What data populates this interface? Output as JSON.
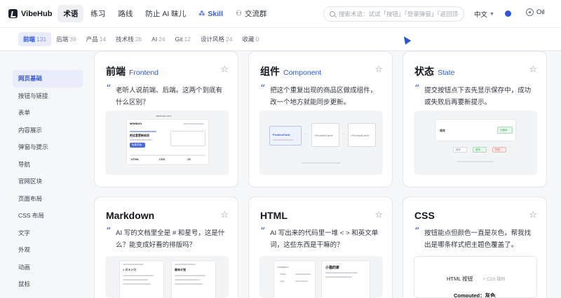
{
  "brand": {
    "name": "VibeHub"
  },
  "nav": {
    "items": [
      {
        "label": "术语",
        "active": true
      },
      {
        "label": "练习"
      },
      {
        "label": "路线"
      },
      {
        "label": "防止 AI 昧儿"
      },
      {
        "label": "Skill"
      },
      {
        "label": "交流群"
      }
    ]
  },
  "search": {
    "placeholder": "搜索术语：试试「按钮」「登录弹窗」「返回顶部」"
  },
  "language": {
    "label": "中文"
  },
  "user": {
    "name": "Oil"
  },
  "categories": [
    {
      "label": "前端",
      "count": "131",
      "active": true
    },
    {
      "label": "后端",
      "count": "39"
    },
    {
      "label": "产品",
      "count": "14"
    },
    {
      "label": "技术栈",
      "count": "26"
    },
    {
      "label": "AI",
      "count": "24"
    },
    {
      "label": "Git",
      "count": "12"
    },
    {
      "label": "设计风格",
      "count": "24"
    },
    {
      "label": "收藏",
      "count": "0"
    }
  ],
  "sidebar": {
    "items": [
      {
        "label": "网页基础",
        "active": true
      },
      {
        "label": "按钮与链接"
      },
      {
        "label": "表单"
      },
      {
        "label": "内容展示"
      },
      {
        "label": "弹窗与提示"
      },
      {
        "label": "导航"
      },
      {
        "label": "官网区块"
      },
      {
        "label": "页面布局"
      },
      {
        "label": "CSS 布局"
      },
      {
        "label": "文字"
      },
      {
        "label": "外观"
      },
      {
        "label": "动画"
      },
      {
        "label": "鼠标"
      }
    ]
  },
  "cards": [
    {
      "title": "前端",
      "subtitle": "Frontend",
      "desc": "老听人说前端、后端。这两个到底有什么区别？"
    },
    {
      "title": "组件",
      "subtitle": "Component",
      "desc": "把这个重复出现的商品区做成组件，改一个地方就能同步更新。"
    },
    {
      "title": "状态",
      "subtitle": "State",
      "desc": "提交按钮点下去先显示保存中，成功或失败后再要新提示。"
    },
    {
      "title": "Markdown",
      "subtitle": "",
      "desc": "AI 写的文档里全是 # 和星号，这是什么？能变成好看的排版吗？"
    },
    {
      "title": "HTML",
      "subtitle": "",
      "desc": "AI 写出来的代码里一堆 < > 和英文单词，这些东西是干嘛的？"
    },
    {
      "title": "CSS",
      "subtitle": "",
      "desc": "按钮能点但颜色一直是灰色，帮我找出是哪条样式把主题色覆盖了。"
    }
  ],
  "previews": {
    "frontend": {
      "url": "vibehub.com",
      "brand": "MINIBAG",
      "headline": "把这套更新给用",
      "btn": "免费开始",
      "tags": [
        "HTML",
        "CSS",
        "JS"
      ]
    },
    "component": {
      "name": "ProductCard",
      "items": [
        "<ProductCard>",
        "<ProductCard>"
      ]
    },
    "state": {
      "label": "保存",
      "status": "已保存",
      "steps": [
        "保存",
        "成功",
        "失败"
      ]
    },
    "markdown": {
      "left": "# 周末计划",
      "right": "周末计划"
    },
    "html": {
      "tags": [
        "<header>",
        "<h1>",
        "<p>"
      ],
      "title": "小猫的家"
    },
    "css": {
      "left": "HTML 按钮",
      "right": "+ CSS 规则",
      "computed": "Computed：灰色"
    }
  },
  "colors": {
    "accent": "#3157d8",
    "background": "#f6f7f9"
  },
  "icons": {
    "star": "star-icon",
    "search": "search-icon",
    "cursor": "cursor-icon",
    "skill": "sparkle-icon",
    "group": "group-icon"
  }
}
